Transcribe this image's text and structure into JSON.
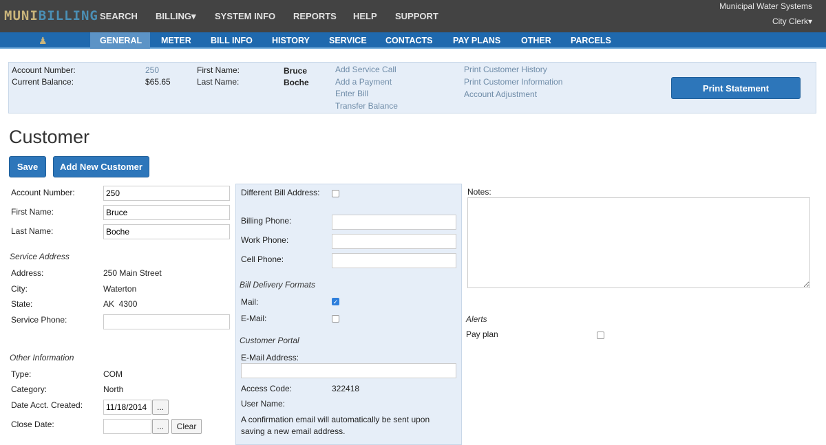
{
  "brand": {
    "part1": "MUNI",
    "part2": "BILLING"
  },
  "topnav": [
    "SEARCH",
    "BILLING▾",
    "SYSTEM INFO",
    "REPORTS",
    "HELP",
    "SUPPORT"
  ],
  "org": "Municipal Water Systems",
  "user": "City Clerk▾",
  "tabs": [
    "GENERAL",
    "METER",
    "BILL INFO",
    "HISTORY",
    "SERVICE",
    "CONTACTS",
    "PAY PLANS",
    "OTHER",
    "PARCELS"
  ],
  "summary": {
    "account_label": "Account Number:",
    "account": "250",
    "balance_label": "Current Balance:",
    "balance": "$65.65",
    "first_label": "First Name:",
    "first": "Bruce",
    "last_label": "Last Name:",
    "last": "Boche",
    "links1": [
      "Add Service Call",
      "Add a Payment",
      "Enter Bill",
      "Transfer Balance"
    ],
    "links2": [
      "Print Customer History",
      "Print Customer Information",
      "Account Adjustment"
    ],
    "print": "Print Statement"
  },
  "title": "Customer",
  "buttons": {
    "save": "Save",
    "add": "Add New Customer"
  },
  "left": {
    "account_label": "Account Number:",
    "account": "250",
    "first_label": "First Name:",
    "first": "Bruce",
    "last_label": "Last Name:",
    "last": "Boche",
    "service_heading": "Service Address",
    "address_label": "Address:",
    "address": "250 Main Street",
    "city_label": "City:",
    "city": "Waterton",
    "state_label": "State:",
    "state": "AK  4300",
    "phone_label": "Service Phone:",
    "other_heading": "Other Information",
    "type_label": "Type:",
    "type": "COM",
    "category_label": "Category:",
    "category": "North",
    "created_label": "Date Acct. Created:",
    "created": "11/18/2014",
    "close_label": "Close Date:",
    "dots": "...",
    "clear": "Clear"
  },
  "mid": {
    "diff_label": "Different Bill Address:",
    "billing_phone": "Billing Phone:",
    "work_phone": "Work Phone:",
    "cell_phone": "Cell Phone:",
    "delivery_heading": "Bill Delivery Formats",
    "mail": "Mail:",
    "mail_checked": true,
    "email": "E-Mail:",
    "email_checked": false,
    "portal_heading": "Customer Portal",
    "email_addr": "E-Mail Address:",
    "access_label": "Access Code:",
    "access": "322418",
    "username_label": "User Name:",
    "note": "A confirmation email will automatically be sent upon saving a new email address."
  },
  "right": {
    "notes_label": "Notes:",
    "alerts_heading": "Alerts",
    "payplan": "Pay plan",
    "payplan_checked": false
  }
}
